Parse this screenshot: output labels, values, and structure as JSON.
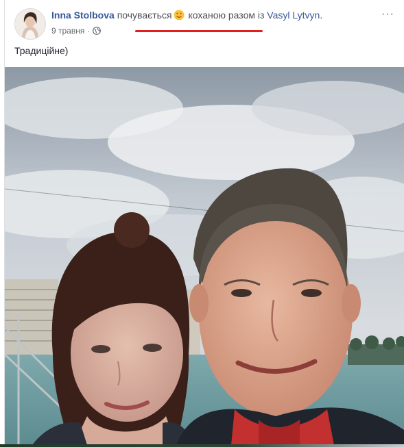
{
  "post": {
    "author": "Inna Stolbova",
    "activity": "почувається",
    "feeling": "коханою",
    "with_word": "разом із",
    "tagged_user": "Vasyl Lytvyn",
    "period": ".",
    "date": "9 травня",
    "dot": "·",
    "privacy_icon": "globe-icon",
    "menu_icon": "more-options-icon",
    "menu_label": "···",
    "text": "Традиційне)",
    "emoji": "smiling-face-with-heart-eyes-emoji",
    "photo_icon": "selfie-photo"
  },
  "colors": {
    "link": "#365899",
    "highlight_underline": "#e0201f",
    "meta": "#616770"
  }
}
